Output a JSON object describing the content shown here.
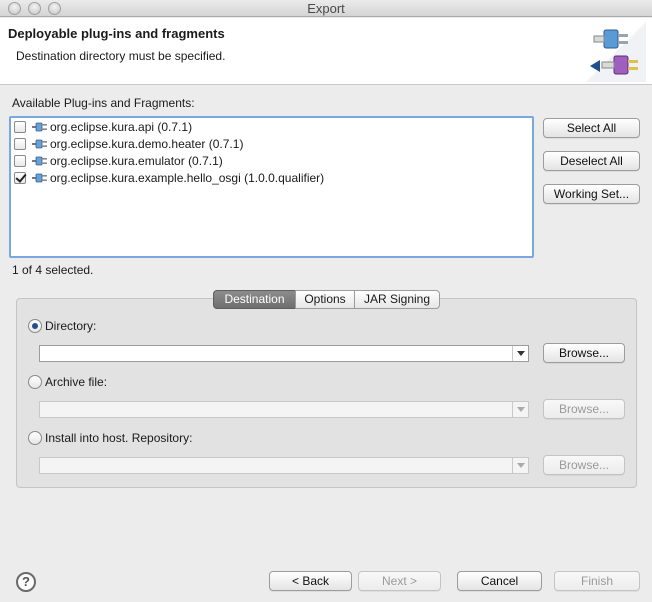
{
  "window": {
    "title": "Export"
  },
  "header": {
    "title": "Deployable plug-ins and fragments",
    "message": "Destination directory must be specified."
  },
  "plugins": {
    "label": "Available Plug-ins and Fragments:",
    "items": [
      {
        "name": "org.eclipse.kura.api (0.7.1)",
        "checked": false
      },
      {
        "name": "org.eclipse.kura.demo.heater (0.7.1)",
        "checked": false
      },
      {
        "name": "org.eclipse.kura.emulator (0.7.1)",
        "checked": false
      },
      {
        "name": "org.eclipse.kura.example.hello_osgi (1.0.0.qualifier)",
        "checked": true
      }
    ],
    "selection_status": "1 of 4 selected."
  },
  "side_buttons": {
    "select_all": "Select All",
    "deselect_all": "Deselect All",
    "working_set": "Working Set..."
  },
  "tabs": [
    "Destination",
    "Options",
    "JAR Signing"
  ],
  "destination": {
    "directory_label": "Directory:",
    "directory_value": "",
    "archive_label": "Archive file:",
    "archive_value": "",
    "install_label": "Install into host. Repository:",
    "install_value": "",
    "browse": "Browse..."
  },
  "footer": {
    "help": "?",
    "back": "< Back",
    "next": "Next >",
    "cancel": "Cancel",
    "finish": "Finish"
  },
  "colors": {
    "list_focus": "#7aa7e0",
    "active_tab": "#7a7a7a"
  }
}
